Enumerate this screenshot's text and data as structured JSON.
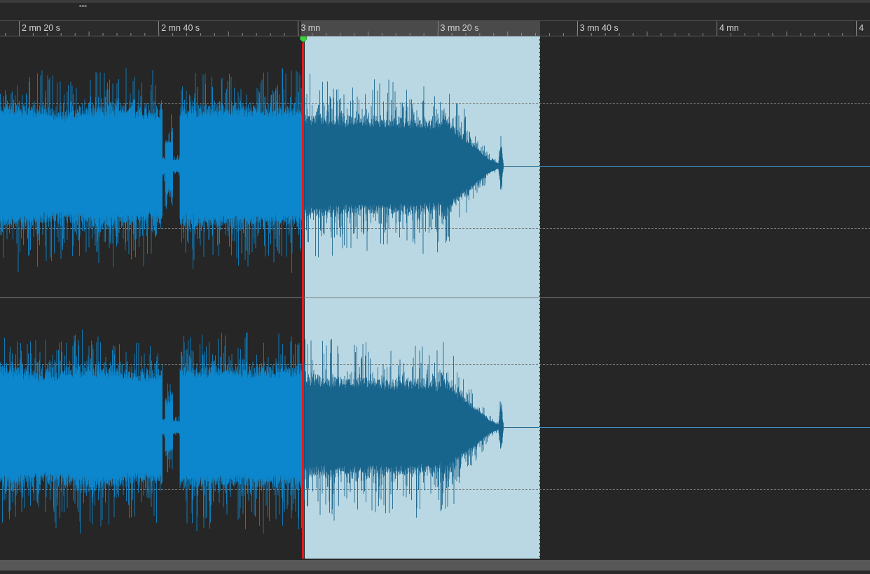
{
  "header": {
    "marker_label": "---"
  },
  "ruler": {
    "labels": [
      "2 mn 20 s",
      "2 mn 40 s",
      "3 mn",
      "3 mn 20 s",
      "3 mn 40 s",
      "4 mn",
      "4"
    ]
  }
}
